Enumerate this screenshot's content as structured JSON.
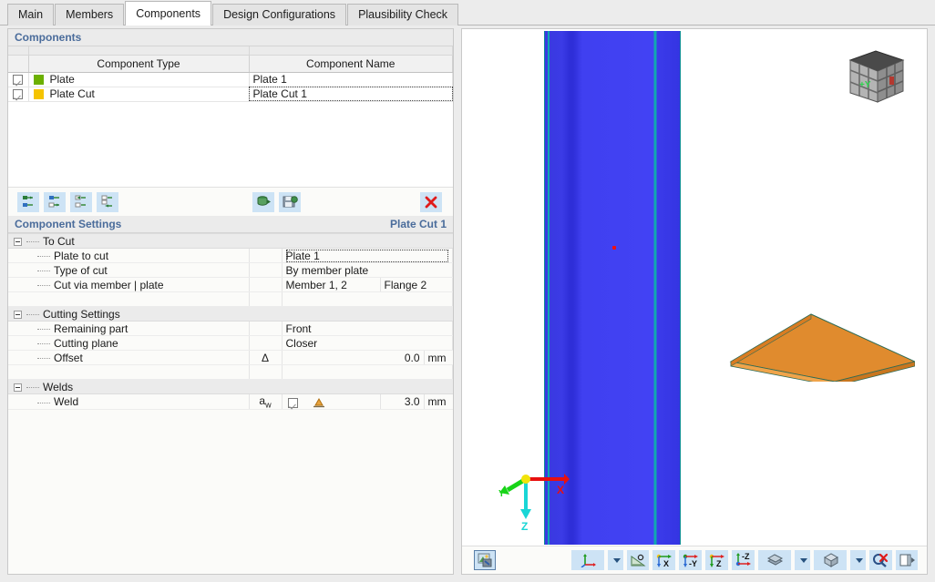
{
  "tabs": [
    {
      "label": "Main",
      "active": false
    },
    {
      "label": "Members",
      "active": false
    },
    {
      "label": "Components",
      "active": true
    },
    {
      "label": "Design Configurations",
      "active": false
    },
    {
      "label": "Plausibility Check",
      "active": false
    }
  ],
  "components_panel": {
    "title": "Components",
    "columns": [
      "Component Type",
      "Component Name"
    ],
    "rows": [
      {
        "checked": true,
        "color": "#6cb000",
        "type": "Plate",
        "name": "Plate 1",
        "editing": false
      },
      {
        "checked": true,
        "color": "#f5c400",
        "type": "Plate Cut",
        "name": "Plate Cut 1",
        "editing": true
      }
    ],
    "toolbar": [
      {
        "name": "new-component-button",
        "icon": "tree-insert-icon"
      },
      {
        "name": "duplicate-component-button",
        "icon": "tree-duplicate-icon"
      },
      {
        "name": "move-component-up-button",
        "icon": "tree-move-in-icon"
      },
      {
        "name": "move-component-down-button",
        "icon": "tree-move-out-icon"
      },
      {
        "name": "import-component-button",
        "icon": "database-import-icon"
      },
      {
        "name": "save-component-button",
        "icon": "save-export-icon"
      },
      {
        "name": "delete-component-button",
        "icon": "red-x-icon"
      }
    ]
  },
  "component_settings": {
    "title": "Component Settings",
    "selected": "Plate Cut 1",
    "sections": [
      {
        "name": "To Cut",
        "expanded": true,
        "rows": [
          {
            "label": "Plate to cut",
            "symbol": "",
            "value": "Plate 1",
            "value2": "",
            "unit": "",
            "editing": true
          },
          {
            "label": "Type of cut",
            "symbol": "",
            "value": "By member plate",
            "value2": "",
            "unit": "",
            "editing": false
          },
          {
            "label": "Cut via member | plate",
            "symbol": "",
            "value": "Member 1, 2",
            "value2": "Flange 2",
            "unit": "",
            "editing": false
          }
        ]
      },
      {
        "name": "Cutting Settings",
        "expanded": true,
        "rows": [
          {
            "label": "Remaining part",
            "symbol": "",
            "value": "Front",
            "value2": "",
            "unit": "",
            "editing": false
          },
          {
            "label": "Cutting plane",
            "symbol": "",
            "value": "Closer",
            "value2": "",
            "unit": "",
            "editing": false
          },
          {
            "label": "Offset",
            "symbol": "Δ",
            "value": "",
            "value2": "0.0",
            "unit": "mm",
            "editing": false
          }
        ]
      },
      {
        "name": "Welds",
        "expanded": true,
        "rows": [
          {
            "label": "Weld",
            "symbol": "aw",
            "value": "",
            "value2": "3.0",
            "unit": "mm",
            "editing": false,
            "checkbox": true,
            "weld_icon": true
          }
        ]
      }
    ]
  },
  "viewport": {
    "viewcube_label": "+Y",
    "axes": {
      "x": "X",
      "y": "Y",
      "z": "Z"
    },
    "toolbar": [
      {
        "name": "render-mode-button",
        "icon": "render-image-icon",
        "framed": true,
        "caret": false
      },
      {
        "name": "coordinate-system-button",
        "icon": "axes-icon",
        "framed": false,
        "caret": true
      },
      {
        "name": "measure-button",
        "icon": "protractor-icon",
        "framed": false,
        "caret": false
      },
      {
        "name": "view-x-button",
        "icon": "view-x-icon",
        "framed": false,
        "caret": false,
        "label": "X"
      },
      {
        "name": "view-neg-y-button",
        "icon": "view-negy-icon",
        "framed": false,
        "caret": false,
        "label": "-Y"
      },
      {
        "name": "view-z-button",
        "icon": "view-z-icon",
        "framed": false,
        "caret": false,
        "label": "Z"
      },
      {
        "name": "view-neg-z-button",
        "icon": "view-negz-icon",
        "framed": false,
        "caret": false,
        "label": "-Z"
      },
      {
        "name": "display-layers-button",
        "icon": "layers-icon",
        "framed": false,
        "caret": true
      },
      {
        "name": "view-box-button",
        "icon": "cube-icon",
        "framed": false,
        "caret": true
      },
      {
        "name": "reset-zoom-button",
        "icon": "zoom-reset-icon",
        "framed": false,
        "caret": false
      },
      {
        "name": "toggle-panel-button",
        "icon": "panel-toggle-icon",
        "framed": false,
        "caret": false
      }
    ]
  },
  "colors": {
    "accent_header": "#4a6c9b",
    "toolbar_button": "#cde3f5",
    "plate_green": "#6cb000",
    "plate_cut_yellow": "#f5c400",
    "member_blue": "#3a3ae0",
    "plate_orange": "#e08b2e",
    "delete_red": "#e01b1b"
  }
}
